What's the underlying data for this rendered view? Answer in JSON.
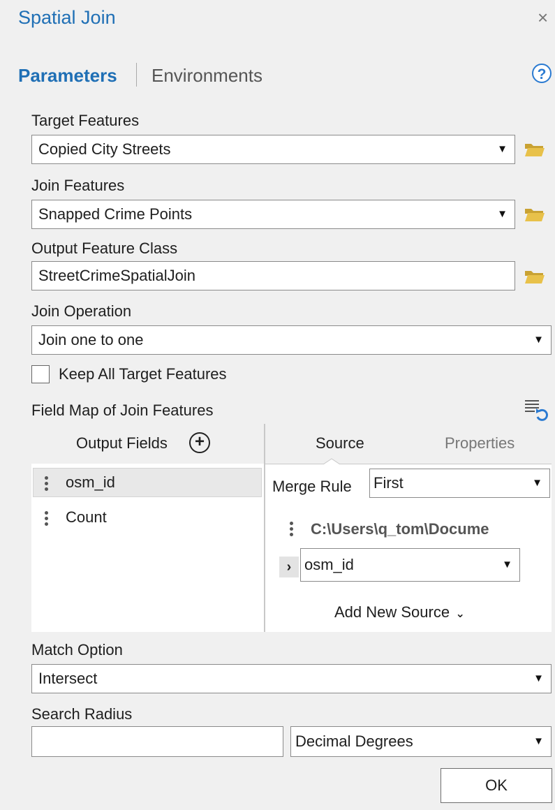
{
  "window": {
    "title": "Spatial Join",
    "close_glyph": "×"
  },
  "tabs": {
    "parameters": "Parameters",
    "environments": "Environments",
    "help_glyph": "?"
  },
  "target_features": {
    "label": "Target Features",
    "value": "Copied City Streets"
  },
  "join_features": {
    "label": "Join Features",
    "value": "Snapped Crime Points"
  },
  "output_feature_class": {
    "label": "Output Feature Class",
    "value": "StreetCrimeSpatialJoin"
  },
  "join_operation": {
    "label": "Join Operation",
    "value": "Join one to one"
  },
  "keep_all": {
    "label": "Keep All Target Features",
    "checked": false
  },
  "field_map": {
    "label": "Field Map of Join Features",
    "output_fields_label": "Output Fields",
    "add_glyph": "+",
    "fields": [
      "osm_id",
      "Count"
    ],
    "tabs": {
      "source": "Source",
      "properties": "Properties"
    },
    "merge_rule_label": "Merge Rule",
    "merge_rule_value": "First",
    "source_path": "C:\\Users\\q_tom\\Docume",
    "source_field": "osm_id",
    "add_new_source": "Add New Source"
  },
  "match_option": {
    "label": "Match Option",
    "value": "Intersect"
  },
  "search_radius": {
    "label": "Search Radius",
    "value": "",
    "units": "Decimal Degrees"
  },
  "ok_button": "OK",
  "colors": {
    "accent": "#1f6fb5",
    "folder": "#e8c14a",
    "background": "#f0f0f0"
  }
}
